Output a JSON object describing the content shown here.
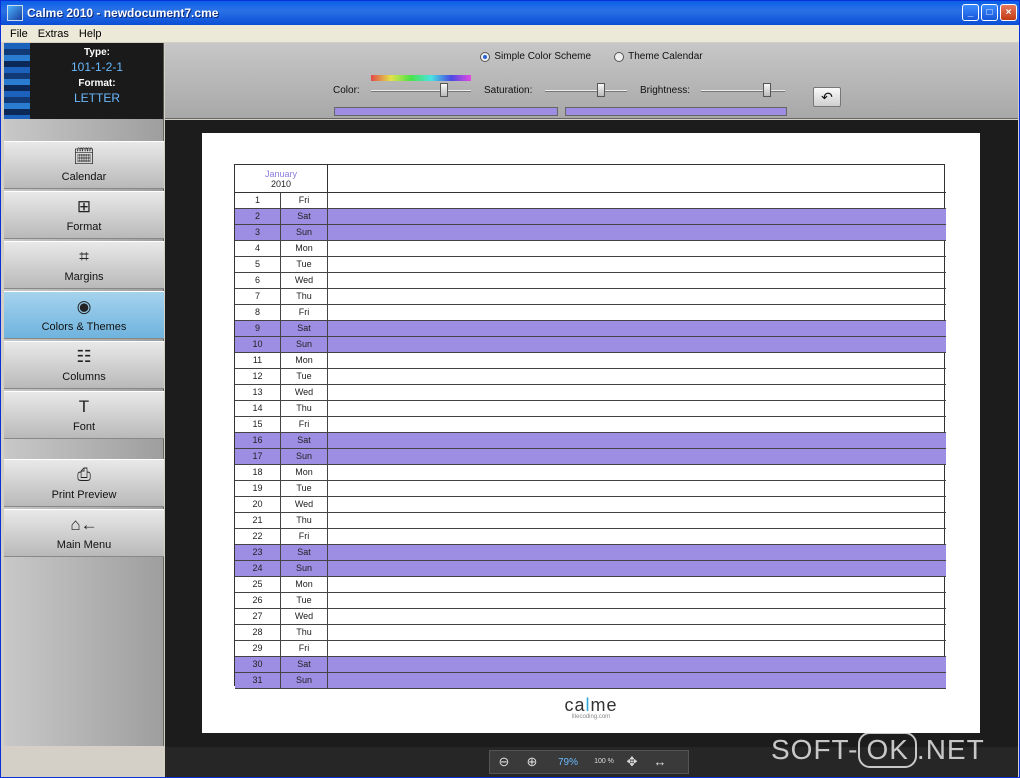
{
  "window": {
    "title": "Calme 2010 - newdocument7.cme",
    "buttons": [
      "_",
      "□",
      "×"
    ]
  },
  "menu": {
    "items": [
      "File",
      "Extras",
      "Help"
    ]
  },
  "info": {
    "type_label": "Type:",
    "type_value": "101-1-2-1",
    "format_label": "Format:",
    "format_value": "LETTER"
  },
  "toolbar": {
    "scheme_simple": "Simple Color Scheme",
    "scheme_theme": "Theme Calendar",
    "selected_scheme": "Simple Color Scheme",
    "color_label": "Color:",
    "saturation_label": "Saturation:",
    "brightness_label": "Brightness:",
    "color_value": 0.75,
    "saturation_value": 0.7,
    "brightness_value": 0.82,
    "swatch_color": "#9d8ee4",
    "undo_icon": "undo-icon"
  },
  "sidebar": {
    "items": [
      {
        "label": "Calendar",
        "icon": "calendar-icon",
        "active": false
      },
      {
        "label": "Format",
        "icon": "format-icon",
        "active": false
      },
      {
        "label": "Margins",
        "icon": "margins-icon",
        "active": false
      },
      {
        "label": "Colors & Themes",
        "icon": "palette-icon",
        "active": true
      },
      {
        "label": "Columns",
        "icon": "columns-icon",
        "active": false
      },
      {
        "label": "Font",
        "icon": "font-icon",
        "active": false
      },
      {
        "label": "Print Preview",
        "icon": "printer-icon",
        "active": false
      },
      {
        "label": "Main Menu",
        "icon": "home-back-icon",
        "active": false
      }
    ]
  },
  "calendar": {
    "month": "January",
    "year": "2010",
    "weekend_color": "#9d8ee4",
    "days": [
      {
        "n": "1",
        "d": "Fri"
      },
      {
        "n": "2",
        "d": "Sat"
      },
      {
        "n": "3",
        "d": "Sun"
      },
      {
        "n": "4",
        "d": "Mon"
      },
      {
        "n": "5",
        "d": "Tue"
      },
      {
        "n": "6",
        "d": "Wed"
      },
      {
        "n": "7",
        "d": "Thu"
      },
      {
        "n": "8",
        "d": "Fri"
      },
      {
        "n": "9",
        "d": "Sat"
      },
      {
        "n": "10",
        "d": "Sun"
      },
      {
        "n": "11",
        "d": "Mon"
      },
      {
        "n": "12",
        "d": "Tue"
      },
      {
        "n": "13",
        "d": "Wed"
      },
      {
        "n": "14",
        "d": "Thu"
      },
      {
        "n": "15",
        "d": "Fri"
      },
      {
        "n": "16",
        "d": "Sat"
      },
      {
        "n": "17",
        "d": "Sun"
      },
      {
        "n": "18",
        "d": "Mon"
      },
      {
        "n": "19",
        "d": "Tue"
      },
      {
        "n": "20",
        "d": "Wed"
      },
      {
        "n": "21",
        "d": "Thu"
      },
      {
        "n": "22",
        "d": "Fri"
      },
      {
        "n": "23",
        "d": "Sat"
      },
      {
        "n": "24",
        "d": "Sun"
      },
      {
        "n": "25",
        "d": "Mon"
      },
      {
        "n": "26",
        "d": "Tue"
      },
      {
        "n": "27",
        "d": "Wed"
      },
      {
        "n": "28",
        "d": "Thu"
      },
      {
        "n": "29",
        "d": "Fri"
      },
      {
        "n": "30",
        "d": "Sat"
      },
      {
        "n": "31",
        "d": "Sun"
      }
    ],
    "logo_brand_1": "ca",
    "logo_brand_2": "l",
    "logo_brand_3": "me",
    "logo_tag": "litecoding.com"
  },
  "zoom": {
    "zoom_out": "zoom-out-icon",
    "zoom_in": "zoom-in-icon",
    "level": "79%",
    "reset": "100 %",
    "fit": "fit-page-icon",
    "width": "fit-width-icon"
  },
  "watermark": {
    "text_1": "SOFT-",
    "text_2": "OK",
    "text_3": ".NET"
  }
}
